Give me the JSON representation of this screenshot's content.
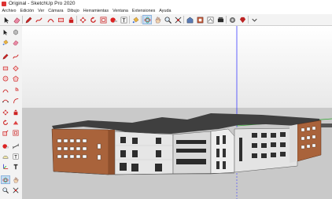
{
  "window": {
    "title": "Original - SketchUp Pro 2020"
  },
  "menu": {
    "items": [
      "Archivo",
      "Edición",
      "Ver",
      "Cámara",
      "Dibujo",
      "Herramientas",
      "Ventana",
      "Extensiones",
      "Ayuda"
    ]
  },
  "colors": {
    "sky": "#ffffff",
    "ground": "#c9c9c9",
    "brick": "#a9633b",
    "roof": "#3f3f3f",
    "facade": "#e6e6e6",
    "axis_blue": "#3b3bff",
    "axis_green": "#2ea52e",
    "axis_red": "#d23030",
    "toolbar_active": "#c7dcf2"
  },
  "toolbar": {
    "icons": [
      "select-arrow-icon",
      "eraser-icon",
      "pencil-icon",
      "freehand-icon",
      "arc-icon",
      "rectangle-icon",
      "push-pull-icon",
      "move-icon",
      "rotate-icon",
      "offset-icon",
      "tape-measure-icon",
      "text-icon",
      "paint-bucket-icon",
      "orbit-icon",
      "pan-icon",
      "zoom-icon",
      "zoom-extents-icon",
      "warehouse-icon",
      "extension-warehouse-icon",
      "layout-icon",
      "components-icon",
      "settings-icon",
      "ruby-icon"
    ]
  },
  "lefttoolbar": {
    "icons": [
      "select-arrow-icon",
      "make-component-icon",
      "paint-bucket-icon",
      "eraser-icon",
      "line-icon",
      "freehand-icon",
      "rectangle-icon",
      "rotated-rectangle-icon",
      "circle-icon",
      "polygon-icon",
      "arc-icon",
      "pie-icon",
      "arc-3pt-icon",
      "arc-2pt-icon",
      "move-icon",
      "push-pull-icon",
      "rotate-icon",
      "follow-me-icon",
      "scale-icon",
      "offset-icon",
      "tape-measure-icon",
      "dimension-icon",
      "protractor-icon",
      "text-icon",
      "axes-icon",
      "3d-text-icon",
      "orbit-icon",
      "pan-icon",
      "zoom-icon",
      "zoom-window-icon",
      "zoom-extents-icon",
      "walk-icon"
    ]
  }
}
